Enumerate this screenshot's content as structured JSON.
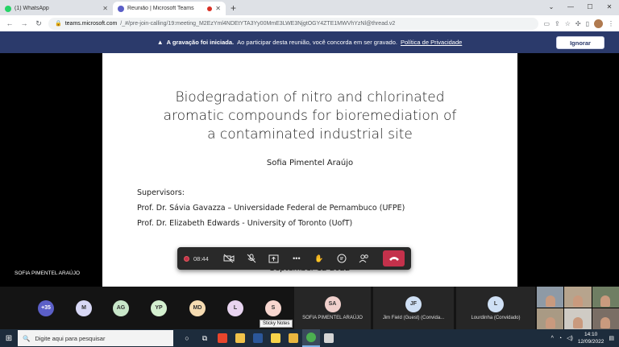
{
  "browser": {
    "tabs": [
      {
        "title": "(1) WhatsApp",
        "favicon_color": "#25d366",
        "active": false
      },
      {
        "title": "Reunião | Microsoft Teams",
        "favicon_color": "#5b5fc7",
        "active": true
      }
    ],
    "new_tab": "+",
    "url_host": "teams.microsoft.com",
    "url_path": "/_#/pre-join-calling/19:meeting_M2EzYml4NDEtYTA3Yy00MmE3LWE3NjgtOGY4ZTE1MWVhYzNl@thread.v2"
  },
  "banner": {
    "bold": "A gravação foi iniciada.",
    "text": "Ao participar desta reunião, você concorda em ser gravado.",
    "link": "Política de Privacidade",
    "ignore_label": "Ignorar",
    "color": "#2b3a6b"
  },
  "slide": {
    "title_lines": [
      "Biodegradation of nitro and chlorinated",
      "aromatic compounds for bioremediation of",
      "a contaminated industrial site"
    ],
    "author": "Sofia Pimentel Araújo",
    "supervisors_label": "Supervisors:",
    "supervisor_1": "Prof. Dr. Sávia Gavazza – Universidade Federal de Pernambuco (UFPE)",
    "supervisor_2": "Prof. Dr. Elizabeth Edwards - University of Toronto (UofT)",
    "date_partial": "September 12  2022"
  },
  "presenter_name": "SOFIA PIMENTEL ARAÚJO",
  "call_toolbar": {
    "timer": "08:44",
    "hangup_color": "#c4314b"
  },
  "participants": [
    {
      "initials": "+35",
      "color": "#5b5fc7"
    },
    {
      "initials": "M",
      "color": "#d7d7f5"
    },
    {
      "initials": "AG",
      "color": "#c8e6c9"
    },
    {
      "initials": "YP",
      "color": "#d4f0d0"
    },
    {
      "initials": "MD",
      "color": "#f6dcb2"
    },
    {
      "initials": "L",
      "color": "#e8d4f0"
    },
    {
      "initials": "S",
      "color": "#f8d7d0"
    }
  ],
  "named_participants": [
    {
      "initials": "SA",
      "name": "SOFIA PIMENTEL ARAÚJO",
      "color": "#f0d0cc"
    },
    {
      "initials": "JF",
      "name": "Jim Field (Guest) (Convida...",
      "color": "#cfe0f5"
    },
    {
      "initials": "L",
      "name": "Lourdinha (Convidado)",
      "color": "#cfe0f5"
    }
  ],
  "tooltip": "Sticky Notes",
  "taskbar": {
    "search_placeholder": "Digite aqui para pesquisar",
    "time": "14:10",
    "date": "12/09/2022"
  }
}
